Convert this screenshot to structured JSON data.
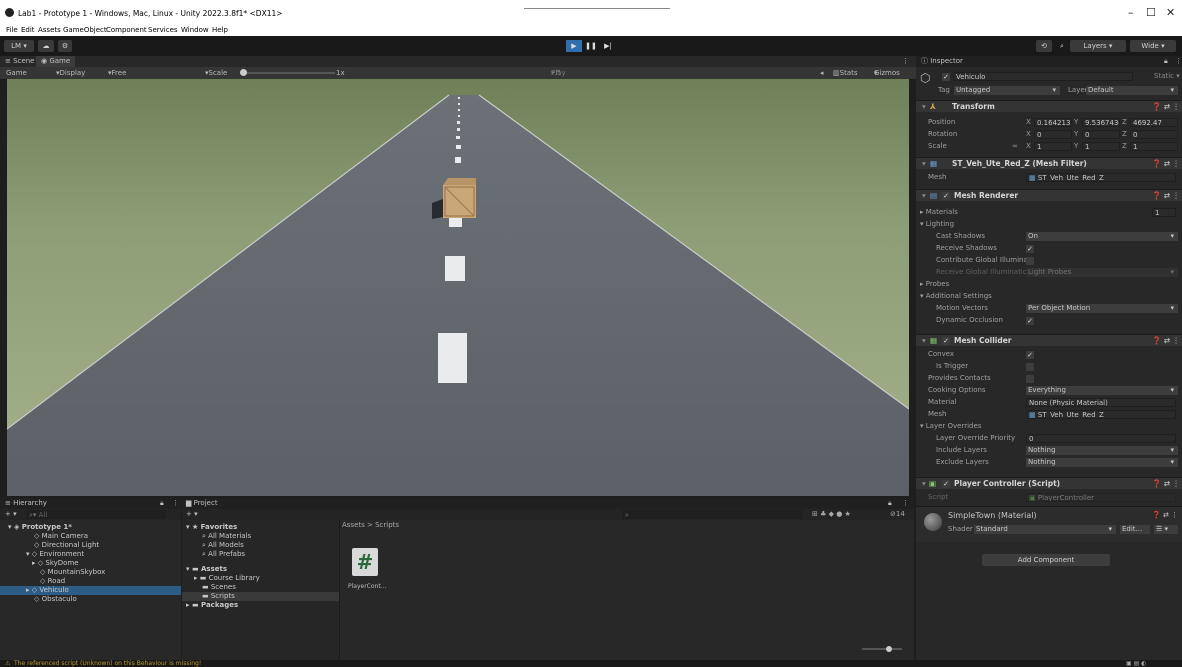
{
  "window": {
    "title": "Lab1 - Prototype 1 - Windows, Mac, Linux - Unity 2022.3.8f1* <DX11>",
    "minimize": "–",
    "maximize": "☐",
    "close": "✕"
  },
  "menu": [
    "File",
    "Edit",
    "Assets",
    "GameObject",
    "Component",
    "Services",
    "Window",
    "Help"
  ],
  "toolbar": {
    "account": "LM ▾",
    "layers": "Layers",
    "layout": "Wide"
  },
  "view_tabs": [
    "Scene",
    "Game"
  ],
  "gamebar": {
    "mode": "Game",
    "display": "Display 1",
    "aspect": "Free Aspect",
    "scale_label": "Scale",
    "scale_value": "1x",
    "play_mode": "Play Focused",
    "stats": "Stats",
    "gizmos": "Gizmos"
  },
  "hierarchy": {
    "title": "Hierarchy",
    "search_placeholder": "All",
    "items": [
      {
        "label": "Prototype 1*"
      },
      {
        "label": "Main Camera"
      },
      {
        "label": "Directional Light"
      },
      {
        "label": "Environment"
      },
      {
        "label": "SkyDome"
      },
      {
        "label": "MountainSkybox"
      },
      {
        "label": "Road"
      },
      {
        "label": "Vehiculo"
      },
      {
        "label": "Obstaculo"
      }
    ]
  },
  "project": {
    "title": "Project",
    "favorites_label": "Favorites",
    "favorites": [
      "All Materials",
      "All Models",
      "All Prefabs"
    ],
    "assets_label": "Assets",
    "assets": [
      "Course Library",
      "Scenes",
      "Scripts"
    ],
    "packages_label": "Packages",
    "breadcrumb": "Assets > Scripts",
    "file_name": "PlayerCont...",
    "file_glyph": "#",
    "count": "14"
  },
  "inspector": {
    "title": "Inspector",
    "object_name": "Vehiculo",
    "static_label": "Static",
    "tag_label": "Tag",
    "tag_value": "Untagged",
    "layer_label": "Layer",
    "layer_value": "Default",
    "transform": {
      "header": "Transform",
      "position_label": "Position",
      "position": {
        "x": "0.1642132",
        "y": "9.536743e",
        "z": "4692.47"
      },
      "rotation_label": "Rotation",
      "rotation": {
        "x": "0",
        "y": "0",
        "z": "0"
      },
      "scale_label": "Scale",
      "scale": {
        "x": "1",
        "y": "1",
        "z": "1"
      }
    },
    "mesh_filter": {
      "header": "ST_Veh_Ute_Red_Z (Mesh Filter)",
      "mesh_label": "Mesh",
      "mesh_value": "ST_Veh_Ute_Red_Z"
    },
    "mesh_renderer": {
      "header": "Mesh Renderer",
      "materials_label": "Materials",
      "materials_count": "1",
      "lighting_label": "Lighting",
      "cast_shadows_label": "Cast Shadows",
      "cast_shadows_value": "On",
      "receive_shadows_label": "Receive Shadows",
      "contribute_gi_label": "Contribute Global Illumina",
      "receive_gi_label": "Receive Global Illuminatic",
      "receive_gi_value": "Light Probes",
      "probes_label": "Probes",
      "additional_label": "Additional Settings",
      "motion_vectors_label": "Motion Vectors",
      "motion_vectors_value": "Per Object Motion",
      "dynamic_occlusion_label": "Dynamic Occlusion"
    },
    "mesh_collider": {
      "header": "Mesh Collider",
      "convex_label": "Convex",
      "is_trigger_label": "Is Trigger",
      "provides_contacts_label": "Provides Contacts",
      "cooking_label": "Cooking Options",
      "cooking_value": "Everything",
      "material_label": "Material",
      "material_value": "None (Physic Material)",
      "mesh_label": "Mesh",
      "mesh_value": "ST_Veh_Ute_Red_Z",
      "layer_overrides_label": "Layer Overrides",
      "priority_label": "Layer Override Priority",
      "priority_value": "0",
      "include_label": "Include Layers",
      "include_value": "Nothing",
      "exclude_label": "Exclude Layers",
      "exclude_value": "Nothing"
    },
    "player_controller": {
      "header": "Player Controller (Script)",
      "script_label": "Script",
      "script_value": "PlayerController"
    },
    "material": {
      "name": "SimpleTown (Material)",
      "shader_label": "Shader",
      "shader_value": "Standard",
      "edit_label": "Edit..."
    },
    "add_component": "Add Component"
  },
  "status": {
    "message": "The referenced script (Unknown) on this Behaviour is missing!"
  }
}
